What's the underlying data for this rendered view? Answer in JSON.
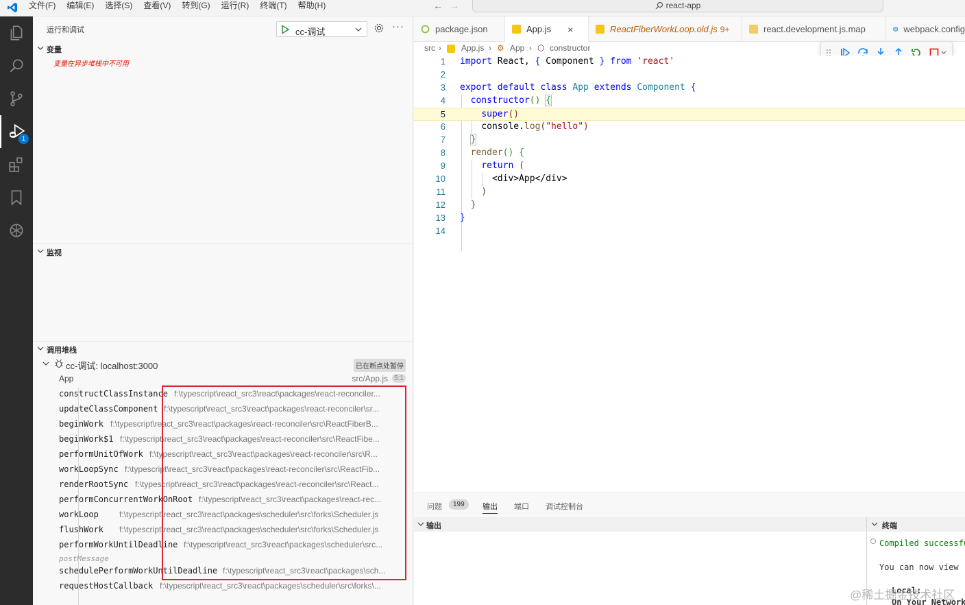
{
  "menu": [
    "文件(F)",
    "编辑(E)",
    "选择(S)",
    "查看(V)",
    "转到(G)",
    "运行(R)",
    "终端(T)",
    "帮助(H)"
  ],
  "command_center": "react-app",
  "activity": {
    "debug_badge": "1"
  },
  "sidebar": {
    "title": "运行和调试",
    "launch_config": "cc-调试",
    "variables": {
      "title": "变量",
      "message": "变量在异步堆栈中不可用"
    },
    "watch": {
      "title": "监视"
    },
    "callstack": {
      "title": "调用堆栈",
      "session": "cc-调试: localhost:3000",
      "paused": "已在断点处暂停",
      "frames": [
        {
          "fn": "App",
          "path": "src/App.js",
          "pos": "5:1"
        },
        {
          "fn": "constructClassInstance",
          "path": "f:\\typescript\\react_src3\\react\\packages\\react-reconciler..."
        },
        {
          "fn": "updateClassComponent",
          "path": "f:\\typescript\\react_src3\\react\\packages\\react-reconciler\\sr..."
        },
        {
          "fn": "beginWork",
          "path": "f:\\typescript\\react_src3\\react\\packages\\react-reconciler\\src\\ReactFiberB..."
        },
        {
          "fn": "beginWork$1",
          "path": "f:\\typescript\\react_src3\\react\\packages\\react-reconciler\\src\\ReactFibe..."
        },
        {
          "fn": "performUnitOfWork",
          "path": "f:\\typescript\\react_src3\\react\\packages\\react-reconciler\\src\\R..."
        },
        {
          "fn": "workLoopSync",
          "path": "f:\\typescript\\react_src3\\react\\packages\\react-reconciler\\src\\ReactFib..."
        },
        {
          "fn": "renderRootSync",
          "path": "f:\\typescript\\react_src3\\react\\packages\\react-reconciler\\src\\React..."
        },
        {
          "fn": "performConcurrentWorkOnRoot",
          "path": "f:\\typescript\\react_src3\\react\\packages\\react-rec..."
        },
        {
          "fn": "workLoop",
          "path": "f:\\typescript\\react_src3\\react\\packages\\scheduler\\src\\forks\\Scheduler.js"
        },
        {
          "fn": "flushWork",
          "path": "f:\\typescript\\react_src3\\react\\packages\\scheduler\\src\\forks\\Scheduler.js"
        },
        {
          "fn": "performWorkUntilDeadline",
          "path": "f:\\typescript\\react_src3\\react\\packages\\scheduler\\src..."
        },
        {
          "fn": "postMessage",
          "path": ""
        },
        {
          "fn": "schedulePerformWorkUntilDeadline",
          "path": "f:\\typescript\\react_src3\\react\\packages\\sch..."
        },
        {
          "fn": "requestHostCallback",
          "path": "f:\\typescript\\react_src3\\react\\packages\\scheduler\\src\\forks\\..."
        }
      ]
    }
  },
  "tabs": [
    {
      "label": "package.json"
    },
    {
      "label": "App.js",
      "close": "×"
    },
    {
      "label": "ReactFiberWorkLoop.old.js",
      "badge": "9+"
    },
    {
      "label": "react.development.js.map"
    },
    {
      "label": "webpack.config"
    }
  ],
  "breadcrumb": [
    "src",
    "App.js",
    "App",
    "constructor"
  ],
  "editor": {
    "current_line": 5,
    "lines": [
      {
        "n": "1",
        "text": "import React, { Component } from 'react'"
      },
      {
        "n": "2",
        "text": ""
      },
      {
        "n": "3",
        "text": "export default class App extends Component {"
      },
      {
        "n": "4",
        "text": "  constructor() {"
      },
      {
        "n": "5",
        "text": "    super()"
      },
      {
        "n": "6",
        "text": "    console.log(\"hello\")"
      },
      {
        "n": "7",
        "text": "  }"
      },
      {
        "n": "8",
        "text": "  render() {"
      },
      {
        "n": "9",
        "text": "    return ("
      },
      {
        "n": "10",
        "text": "      <div>App</div>"
      },
      {
        "n": "11",
        "text": "    )"
      },
      {
        "n": "12",
        "text": "  }"
      },
      {
        "n": "13",
        "text": "}"
      },
      {
        "n": "14",
        "text": ""
      }
    ]
  },
  "panel": {
    "tabs": [
      "问题",
      "输出",
      "端口",
      "调试控制台"
    ],
    "problems_count": "199",
    "output_title": "输出",
    "terminal_title": "终端",
    "terminal_lines": [
      "Compiled successfully!",
      "You can now view react-app in the browser.",
      "Local:",
      "On Your Network:"
    ]
  },
  "watermark": "@稀土掘金技术社区",
  "colors": {
    "activity_bg": "#2c2c2c",
    "accent": "#0078d4",
    "highlight_box": "#d9232e",
    "current_line": "#fffbd6"
  }
}
